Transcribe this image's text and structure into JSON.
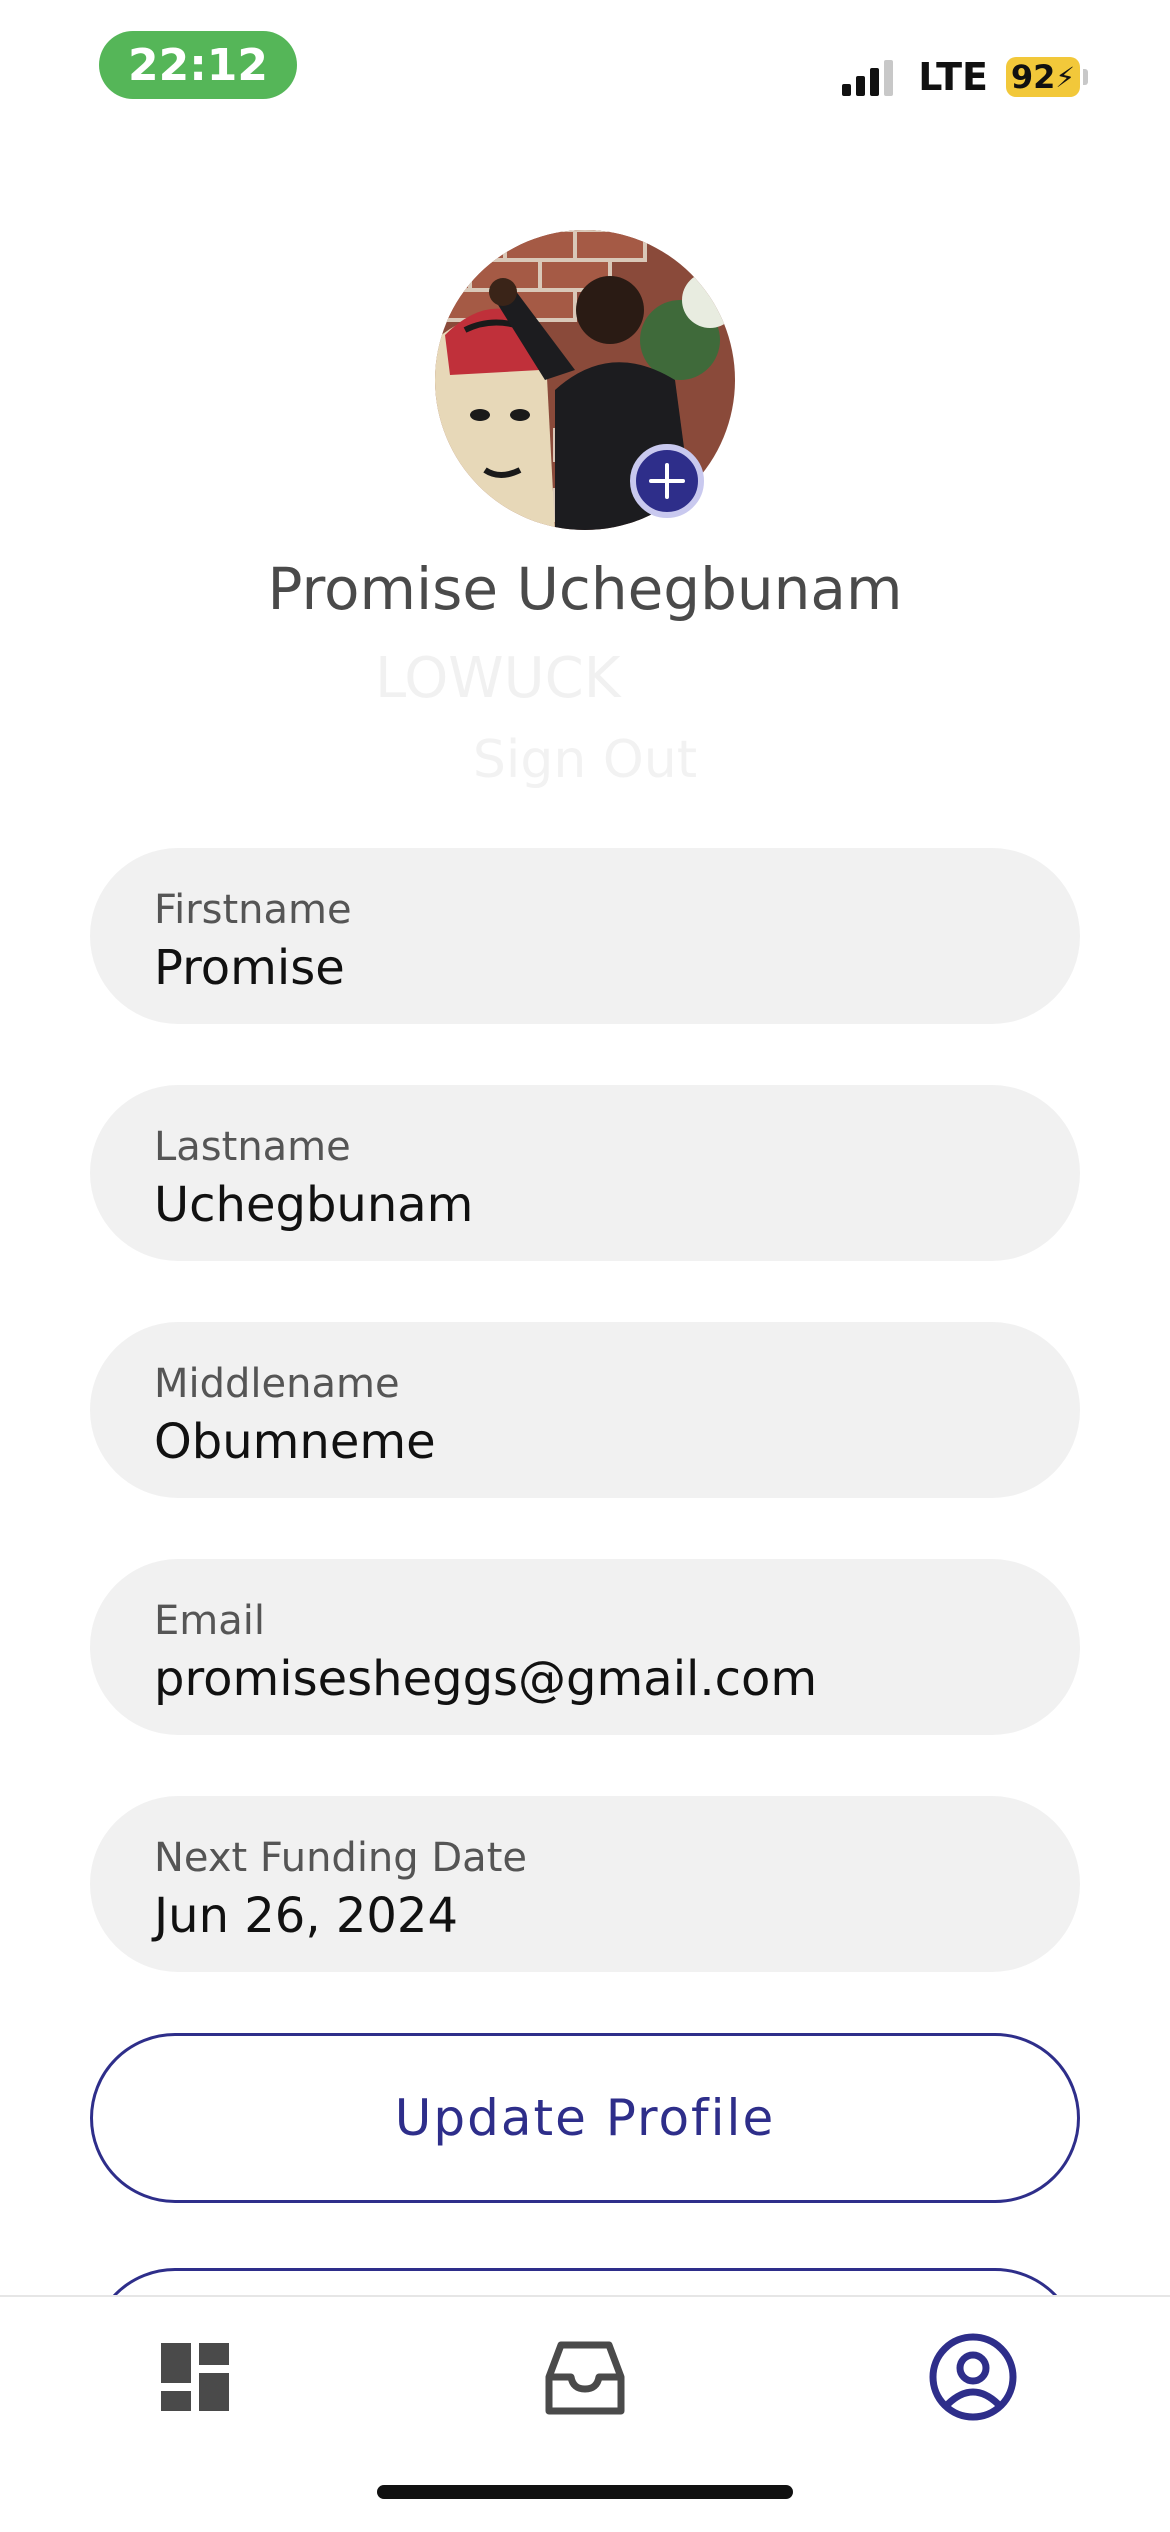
{
  "status_bar": {
    "time": "22:12",
    "network": "LTE",
    "battery": "92"
  },
  "profile": {
    "name": "Promise Uchegbunam",
    "avatar_icon": "profile-photo",
    "add_photo_icon": "plus-icon",
    "faded_text_1": "LOWUCK",
    "faded_text_2": "Sign Out"
  },
  "fields": {
    "firstname": {
      "label": "Firstname",
      "value": "Promise"
    },
    "lastname": {
      "label": "Lastname",
      "value": "Uchegbunam"
    },
    "middlename": {
      "label": "Middlename",
      "value": "Obumneme"
    },
    "email": {
      "label": "Email",
      "value": "promisesheggs@gmail.com"
    },
    "next_funding": {
      "label": "Next Funding Date",
      "value": "Jun 26, 2024"
    }
  },
  "actions": {
    "update_profile": "Update Profile"
  },
  "tabbar": {
    "items": [
      {
        "icon": "dashboard-icon",
        "active": false
      },
      {
        "icon": "inbox-icon",
        "active": false
      },
      {
        "icon": "user-circle-icon",
        "active": true
      }
    ]
  },
  "colors": {
    "accent": "#2e2e8a",
    "time_pill": "#55b658",
    "battery": "#f2c83a",
    "field_bg": "#f1f1f1"
  }
}
